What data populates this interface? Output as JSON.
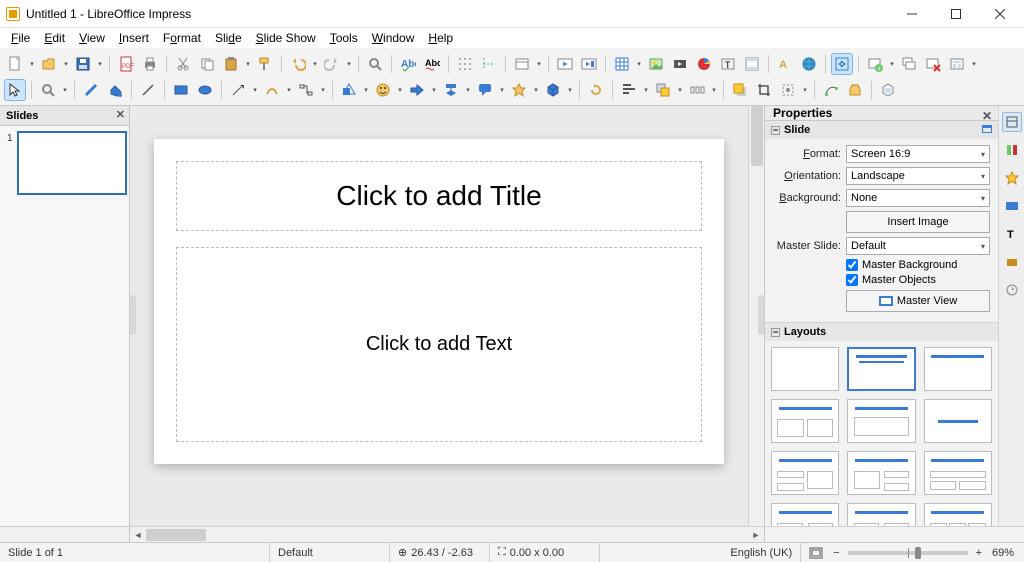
{
  "window": {
    "title": "Untitled 1 - LibreOffice Impress"
  },
  "menu": [
    "File",
    "Edit",
    "View",
    "Insert",
    "Format",
    "Slide",
    "Slide Show",
    "Tools",
    "Window",
    "Help"
  ],
  "panels": {
    "slides_title": "Slides",
    "properties_title": "Properties",
    "slide_section": "Slide",
    "layouts_section": "Layouts"
  },
  "slide_panel": {
    "thumb_number": "1"
  },
  "canvas": {
    "title_placeholder": "Click to add Title",
    "body_placeholder": "Click to add Text"
  },
  "props": {
    "format_label": "Format:",
    "format_value": "Screen 16:9",
    "orientation_label": "Orientation:",
    "orientation_value": "Landscape",
    "background_label": "Background:",
    "background_value": "None",
    "insert_image": "Insert Image",
    "master_slide_label": "Master Slide:",
    "master_slide_value": "Default",
    "chk_master_bg": "Master Background",
    "chk_master_obj": "Master Objects",
    "master_view": "Master View"
  },
  "status": {
    "slide_of": "Slide 1 of 1",
    "style": "Default",
    "coords": "26.43 / -2.63",
    "size": "0.00 x 0.00",
    "lang": "English (UK)",
    "zoom": "69%"
  }
}
